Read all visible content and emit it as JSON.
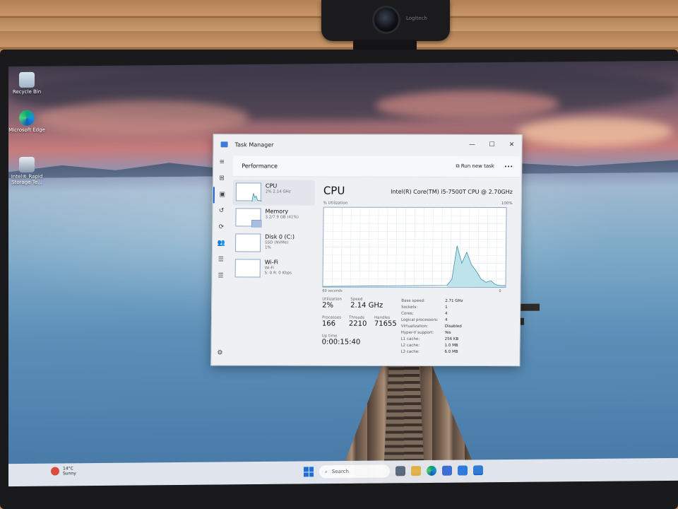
{
  "desktop": {
    "icons": [
      {
        "label": "Recycle Bin"
      },
      {
        "label": "Microsoft Edge"
      },
      {
        "label": "Intel® Rapid Storage Te..."
      }
    ]
  },
  "webcam": {
    "brand": "Logitech"
  },
  "task_manager": {
    "window_title": "Task Manager",
    "page_title": "Performance",
    "run_new_task": "Run new task",
    "more": "•••",
    "window_buttons": {
      "minimize": "—",
      "maximize": "☐",
      "close": "✕"
    },
    "nav": [
      "≡",
      "⊞",
      "▣",
      "↺",
      "⟳",
      "👥",
      "☰",
      "⚙"
    ],
    "resources": [
      {
        "name": "CPU",
        "sub": "2% 2.14 GHz"
      },
      {
        "name": "Memory",
        "sub": "3.2/7.9 GB (41%)"
      },
      {
        "name": "Disk 0 (C:)",
        "sub": "SSD (NVMe)",
        "sub2": "1%"
      },
      {
        "name": "Wi-Fi",
        "sub": "Wi-Fi",
        "sub2": "S: 0 R: 0 Kbps"
      }
    ],
    "detail": {
      "title": "CPU",
      "model": "Intel(R) Core(TM) i5-7500T CPU @ 2.70GHz",
      "util_label": "% Utilization",
      "max_label": "100%",
      "seconds_label": "60 seconds",
      "zero_label": "0",
      "stats": {
        "utilization_label": "Utilization",
        "utilization": "2%",
        "speed_label": "Speed",
        "speed": "2.14 GHz",
        "processes_label": "Processes",
        "processes": "166",
        "threads_label": "Threads",
        "threads": "2210",
        "handles_label": "Handles",
        "handles": "71655",
        "uptime_label": "Up time",
        "uptime": "0:00:15:40"
      },
      "specs": [
        {
          "k": "Base speed:",
          "v": "2.71 GHz"
        },
        {
          "k": "Sockets:",
          "v": "1"
        },
        {
          "k": "Cores:",
          "v": "4"
        },
        {
          "k": "Logical processors:",
          "v": "4"
        },
        {
          "k": "Virtualization:",
          "v": "Disabled"
        },
        {
          "k": "Hyper-V support:",
          "v": "Yes"
        },
        {
          "k": "L1 cache:",
          "v": "256 KB"
        },
        {
          "k": "L2 cache:",
          "v": "1.0 MB"
        },
        {
          "k": "L3 cache:",
          "v": "6.0 MB"
        }
      ]
    }
  },
  "chart_data": {
    "type": "area",
    "title": "CPU",
    "xlabel": "60 seconds",
    "ylabel": "% Utilization",
    "ylim": [
      0,
      100
    ],
    "x": [
      0,
      2,
      4,
      6,
      8,
      10,
      12,
      14,
      16,
      18,
      20,
      22,
      24,
      26,
      28,
      30,
      32,
      34,
      36,
      38,
      40,
      42,
      44,
      46,
      48,
      50,
      52,
      54,
      56,
      58,
      60
    ],
    "series": [
      {
        "values": [
          0,
          0,
          0,
          0,
          0,
          0,
          0,
          0,
          0,
          0,
          0,
          0,
          0,
          0,
          0,
          0,
          0,
          0,
          0,
          0,
          0,
          0,
          0,
          0,
          0,
          0,
          0,
          0,
          0,
          0,
          0
        ]
      }
    ],
    "tail_values": [
      2,
      10,
      52,
      30,
      44,
      28,
      20,
      10,
      6,
      8,
      3,
      2,
      2
    ]
  },
  "taskbar": {
    "weather_temp": "14°C",
    "weather_desc": "Sunny",
    "search_placeholder": "Search"
  }
}
